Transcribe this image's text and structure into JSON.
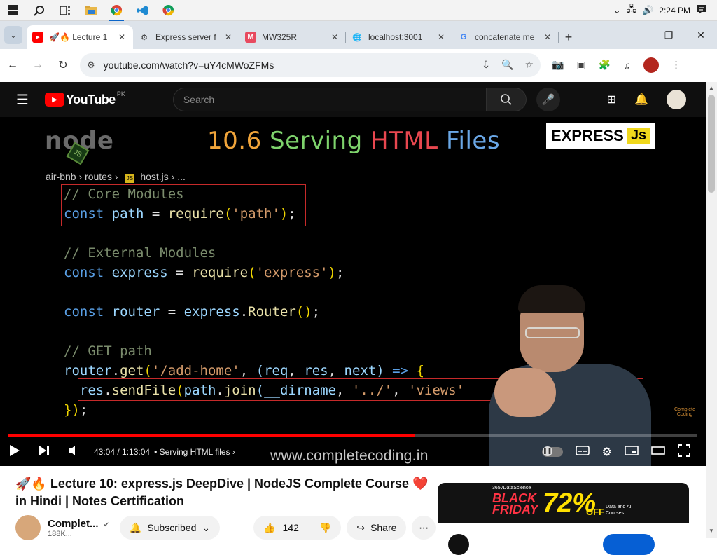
{
  "taskbar": {
    "icons": [
      "windows-start",
      "search",
      "task-view",
      "file-explorer",
      "chrome",
      "vscode",
      "chrome-profile"
    ],
    "time": "2:24 PM"
  },
  "browser": {
    "tabs": [
      {
        "title": "🚀🔥 Lecture 1",
        "favicon": "youtube",
        "active": true
      },
      {
        "title": "Express server f",
        "favicon": "globe",
        "active": false
      },
      {
        "title": "MW325R",
        "favicon": "M",
        "active": false
      },
      {
        "title": "localhost:3001",
        "favicon": "globe",
        "active": false
      },
      {
        "title": "concatenate me",
        "favicon": "google",
        "active": false
      }
    ],
    "url": "youtube.com/watch?v=uY4cMWoZFMs"
  },
  "youtube": {
    "logo_text": "YouTube",
    "country": "PK",
    "search_placeholder": "Search"
  },
  "video": {
    "slide": {
      "title_num": "10.6",
      "title_serving": "Serving",
      "title_html": "HTML",
      "title_files": "Files",
      "node_logo": "node",
      "node_js": "JS",
      "express_badge": "EXPRESS",
      "express_js": "Js",
      "breadcrumb_folder": "air-bnb",
      "breadcrumb_sub": "routes",
      "breadcrumb_file": "host.js",
      "breadcrumb_more": "...",
      "crumb_js_icon": "JS"
    },
    "code_lines": [
      {
        "tokens": [
          {
            "t": "// Core Modules",
            "c": "cm"
          }
        ]
      },
      {
        "tokens": [
          {
            "t": "const",
            "c": "kw"
          },
          {
            "t": " path ",
            "c": "vr"
          },
          {
            "t": "= ",
            "c": "op"
          },
          {
            "t": "require",
            "c": "fn"
          },
          {
            "t": "(",
            "c": "pn"
          },
          {
            "t": "'path'",
            "c": "st"
          },
          {
            "t": ")",
            "c": "pn"
          },
          {
            "t": ";",
            "c": "op"
          }
        ]
      },
      {
        "tokens": []
      },
      {
        "tokens": [
          {
            "t": "// External Modules",
            "c": "cm"
          }
        ]
      },
      {
        "tokens": [
          {
            "t": "const",
            "c": "kw"
          },
          {
            "t": " express ",
            "c": "vr"
          },
          {
            "t": "= ",
            "c": "op"
          },
          {
            "t": "require",
            "c": "fn"
          },
          {
            "t": "(",
            "c": "pn"
          },
          {
            "t": "'express'",
            "c": "st"
          },
          {
            "t": ")",
            "c": "pn"
          },
          {
            "t": ";",
            "c": "op"
          }
        ]
      },
      {
        "tokens": []
      },
      {
        "tokens": [
          {
            "t": "const",
            "c": "kw"
          },
          {
            "t": " router ",
            "c": "vr"
          },
          {
            "t": "= ",
            "c": "op"
          },
          {
            "t": "express",
            "c": "vr"
          },
          {
            "t": ".",
            "c": "op"
          },
          {
            "t": "Router",
            "c": "fn"
          },
          {
            "t": "()",
            "c": "pn"
          },
          {
            "t": ";",
            "c": "op"
          }
        ]
      },
      {
        "tokens": []
      },
      {
        "tokens": [
          {
            "t": "// GET path",
            "c": "cm"
          }
        ]
      },
      {
        "tokens": [
          {
            "t": "router",
            "c": "vr"
          },
          {
            "t": ".",
            "c": "op"
          },
          {
            "t": "get",
            "c": "fn"
          },
          {
            "t": "(",
            "c": "pn"
          },
          {
            "t": "'/add-home'",
            "c": "st"
          },
          {
            "t": ", ",
            "c": "op"
          },
          {
            "t": "(",
            "c": "pm"
          },
          {
            "t": "req",
            "c": "vr"
          },
          {
            "t": ", ",
            "c": "op"
          },
          {
            "t": "res",
            "c": "vr"
          },
          {
            "t": ", ",
            "c": "op"
          },
          {
            "t": "next",
            "c": "vr"
          },
          {
            "t": ") ",
            "c": "pm"
          },
          {
            "t": "=>",
            "c": "arrow-kw"
          },
          {
            "t": " {",
            "c": "pn"
          }
        ]
      },
      {
        "tokens": [
          {
            "t": "  res",
            "c": "vr"
          },
          {
            "t": ".",
            "c": "op"
          },
          {
            "t": "sendFile",
            "c": "fn"
          },
          {
            "t": "(",
            "c": "pn"
          },
          {
            "t": "path",
            "c": "vr"
          },
          {
            "t": ".",
            "c": "op"
          },
          {
            "t": "join",
            "c": "fn"
          },
          {
            "t": "(",
            "c": "pm"
          },
          {
            "t": "__dirname",
            "c": "vr"
          },
          {
            "t": ", ",
            "c": "op"
          },
          {
            "t": "'../'",
            "c": "st"
          },
          {
            "t": ", ",
            "c": "op"
          },
          {
            "t": "'views'",
            "c": "st"
          }
        ]
      },
      {
        "tokens": [
          {
            "t": "})",
            "c": "pn"
          },
          {
            "t": ";",
            "c": "op"
          }
        ]
      }
    ],
    "code_end_paren": "));",
    "watermark": "www.completecoding.in",
    "cc_logo": "Complete Coding"
  },
  "player": {
    "time_current": "43:04",
    "time_total": "1:13:04",
    "time_separator": " / ",
    "chapter_bullet": "•",
    "chapter": "Serving HTML files",
    "progress_played": 0.589,
    "progress_loaded": 0.59
  },
  "details": {
    "title": "🚀🔥 Lecture 10: express.js DeepDive | NodeJS Complete Course",
    "title_heart": "❤️",
    "title_end": "in Hindi | Notes Certification",
    "channel": "Complet...",
    "subscribers": "188K...",
    "subscribed_label": "Subscribed",
    "likes": "142",
    "share_label": "Share"
  },
  "ad": {
    "brand": "365√DataScience",
    "line1": "BLACK",
    "line2": "FRIDAY",
    "discount": "72%",
    "off": "OFF",
    "desc": "Data and AI Courses"
  },
  "colors": {
    "yt_red": "#ff0000",
    "player_bg": "#000000",
    "header_bg": "#0f0f0f",
    "highlight_box": "#c62a2a",
    "accent_blue": "#065fd4"
  }
}
